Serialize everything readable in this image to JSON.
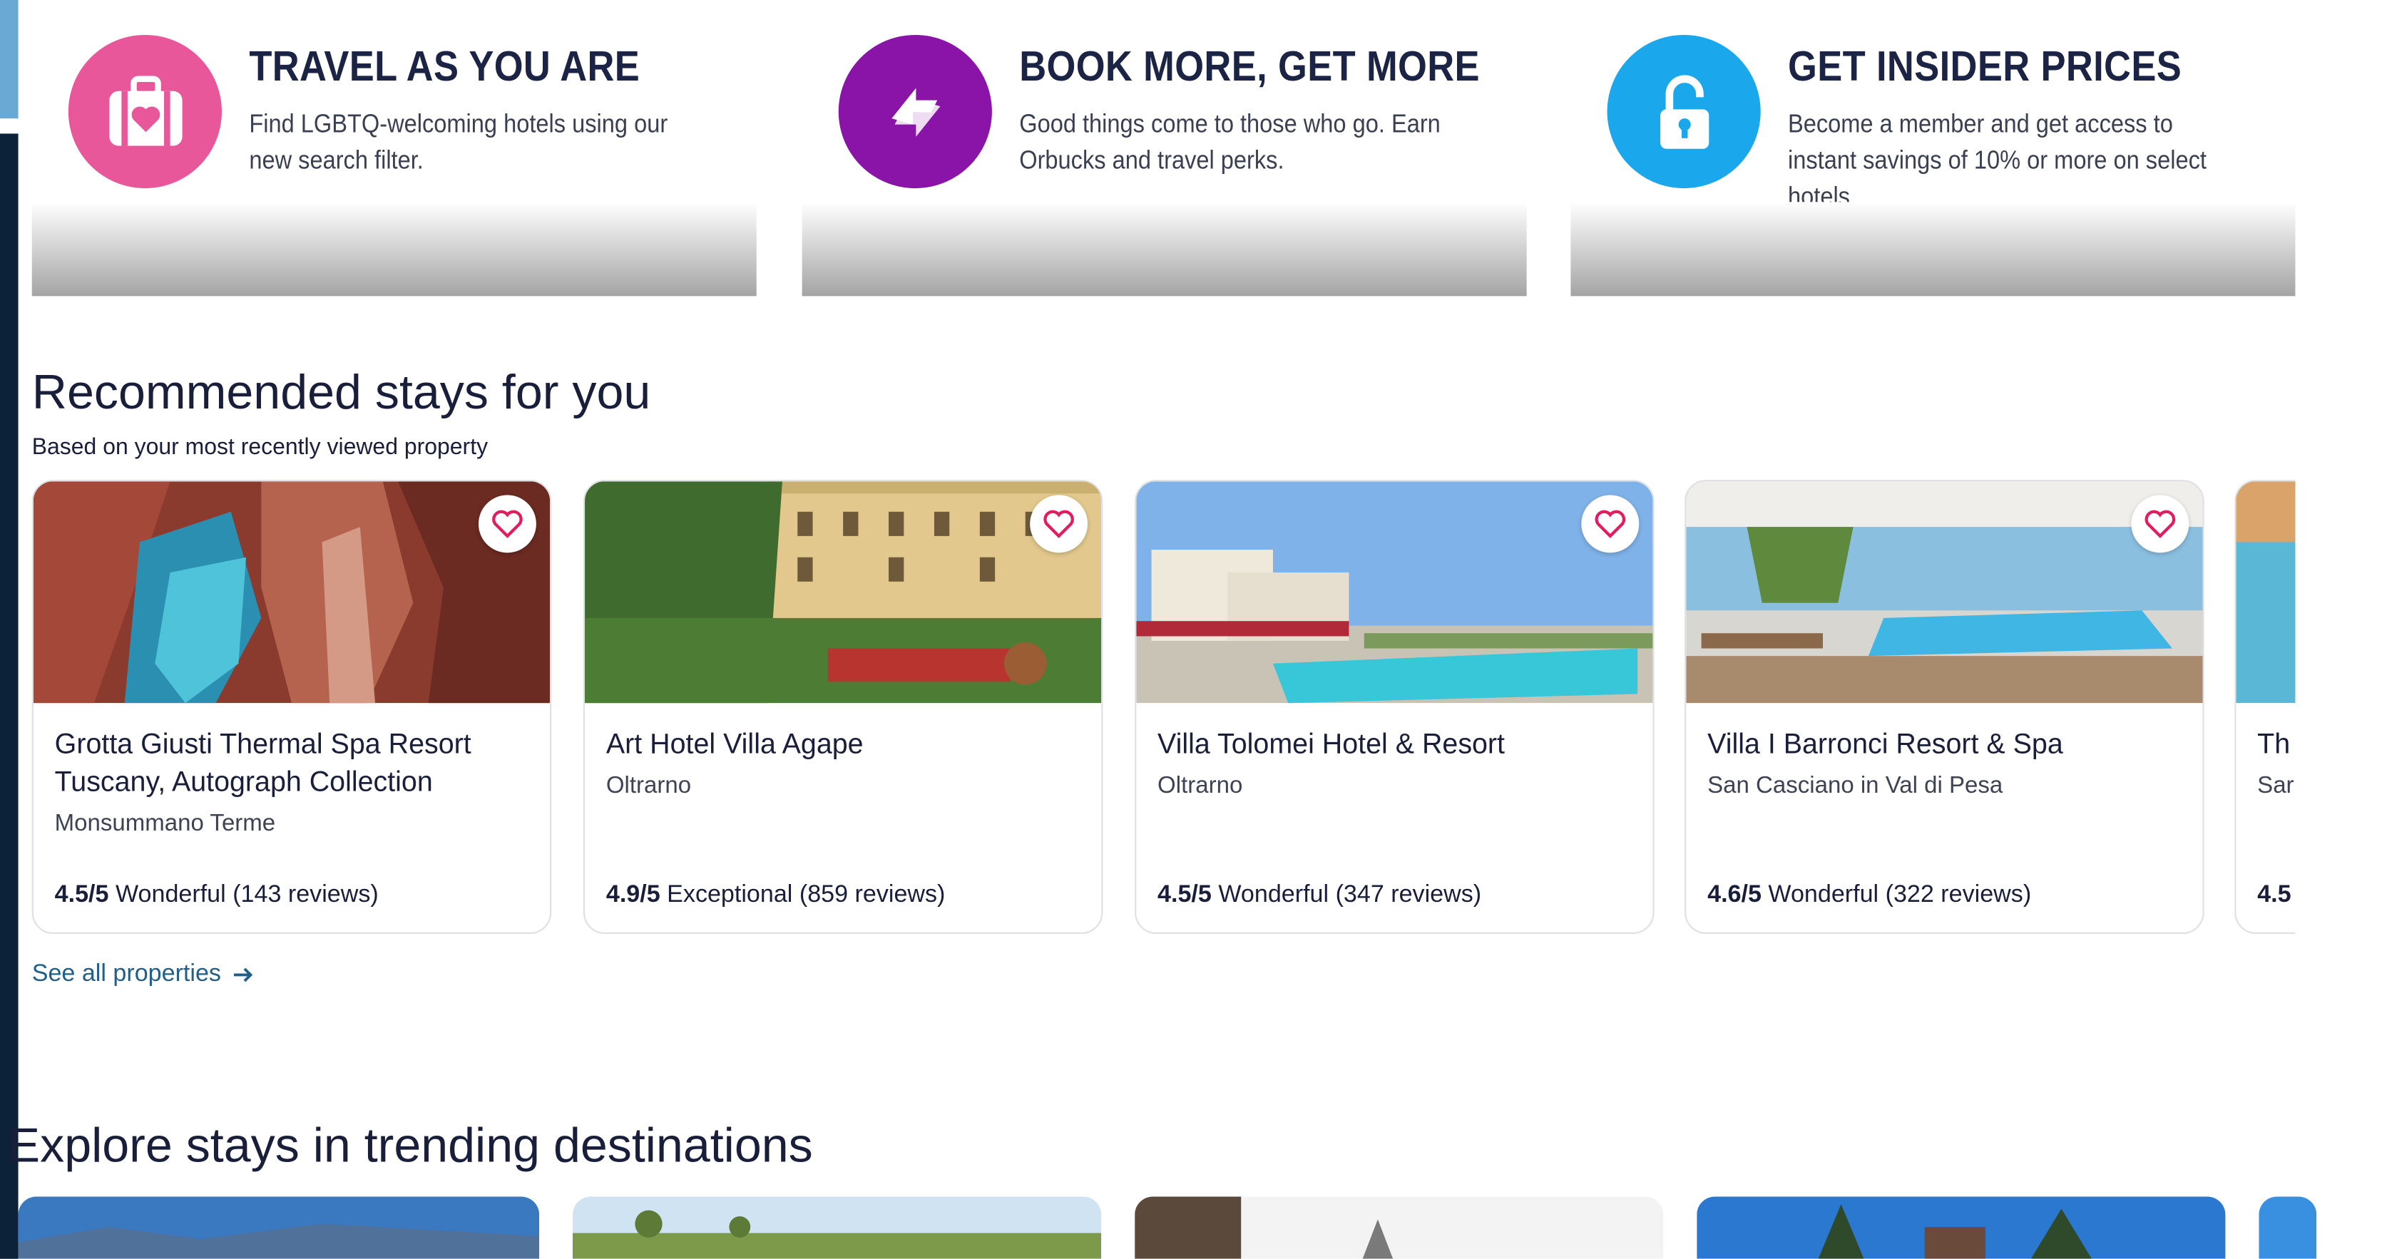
{
  "promos": [
    {
      "title": "TRAVEL AS YOU ARE",
      "desc": "Find LGBTQ-welcoming hotels using our new search filter.",
      "icon": "suitcase-heart-icon",
      "color": "#e8579a"
    },
    {
      "title": "BOOK MORE, GET MORE",
      "desc": "Good things come to those who go. Earn Orbucks and travel perks.",
      "icon": "exchange-arrows-icon",
      "color": "#8a14a8"
    },
    {
      "title": "GET INSIDER PRICES",
      "desc": "Become a member and get access to instant savings of 10% or more on select hotels.",
      "icon": "unlock-icon",
      "color": "#1aa7ec"
    }
  ],
  "recommended": {
    "title": "Recommended stays for you",
    "subtitle": "Based on your most recently viewed property",
    "properties": [
      {
        "name": "Grotta Giusti Thermal Spa Resort Tuscany, Autograph Collection",
        "location": "Monsummano Terme",
        "score": "4.5/5",
        "label": "Wonderful",
        "reviews": "(143 reviews)"
      },
      {
        "name": "Art Hotel Villa Agape",
        "location": "Oltrarno",
        "score": "4.9/5",
        "label": "Exceptional",
        "reviews": "(859 reviews)"
      },
      {
        "name": "Villa Tolomei Hotel & Resort",
        "location": "Oltrarno",
        "score": "4.5/5",
        "label": "Wonderful",
        "reviews": "(347 reviews)"
      },
      {
        "name": "Villa I Barronci Resort & Spa",
        "location": "San Casciano in Val di Pesa",
        "score": "4.6/5",
        "label": "Wonderful",
        "reviews": "(322 reviews)"
      },
      {
        "name": "Th",
        "location": "Sar",
        "score": "4.5",
        "label": "",
        "reviews": ""
      }
    ],
    "see_all": "See all properties"
  },
  "trending": {
    "title": "Explore stays in trending destinations"
  }
}
